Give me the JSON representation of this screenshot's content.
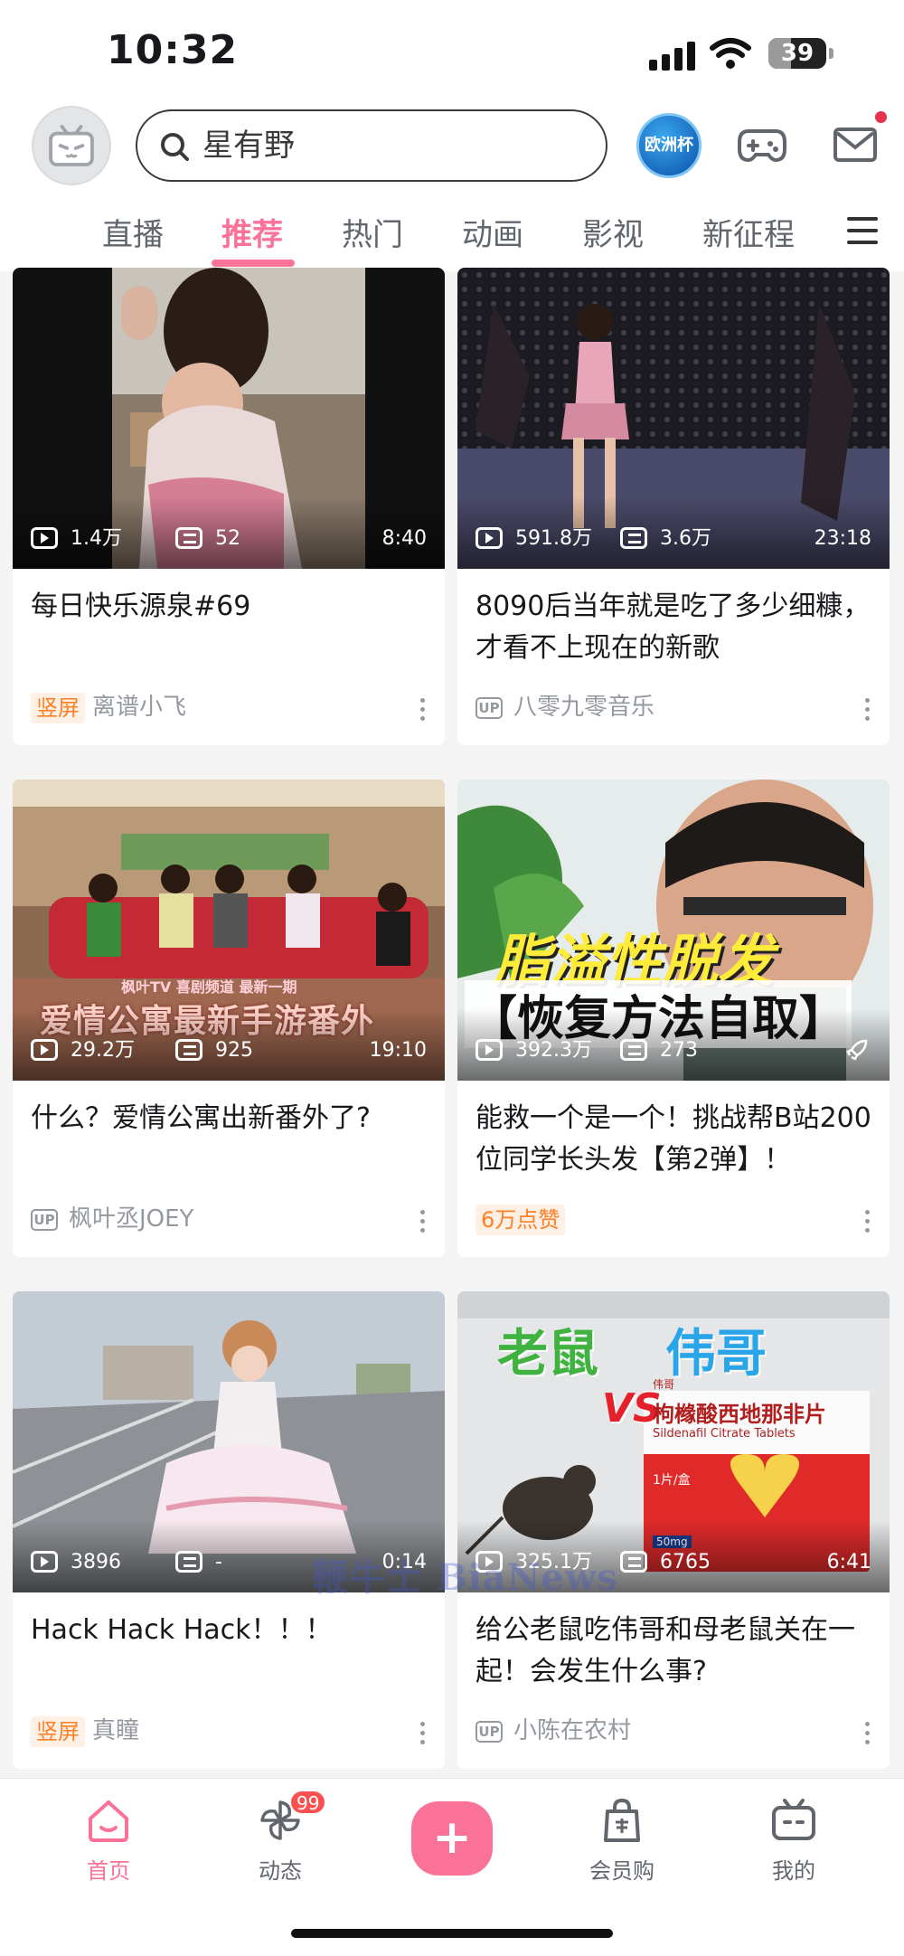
{
  "status_bar": {
    "time": "10:32",
    "battery": "39",
    "battery_level": 0.39
  },
  "header": {
    "search_text": "星有野",
    "euro_badge": "欧洲杯",
    "mail_has_notification": true
  },
  "tabs": [
    {
      "label": "直播"
    },
    {
      "label": "推荐"
    },
    {
      "label": "热门"
    },
    {
      "label": "动画"
    },
    {
      "label": "影视"
    },
    {
      "label": "新征程"
    }
  ],
  "active_tab": "推荐",
  "feed": [
    {
      "title": "每日快乐源泉#69",
      "views": "1.4万",
      "danmaku": "52",
      "duration": "8:40",
      "tag": "竖屏",
      "tag_type": "text",
      "author": "离谱小飞"
    },
    {
      "title": "8090后当年就是吃了多少细糠，才看不上现在的新歌",
      "views": "591.8万",
      "danmaku": "3.6万",
      "duration": "23:18",
      "tag": "UP",
      "tag_type": "up",
      "author": "八零九零音乐"
    },
    {
      "title": "什么？爱情公寓出新番外了?",
      "views": "29.2万",
      "danmaku": "925",
      "duration": "19:10",
      "tag": "UP",
      "tag_type": "up",
      "author": "枫叶丞JOEY",
      "thumb_caption_top": "枫叶TV 喜剧频道 最新一期",
      "thumb_caption": "爱情公寓最新手游番外"
    },
    {
      "title": "能救一个是一个！挑战帮B站200位同学长头发【第2弹】！",
      "views": "392.3万",
      "danmaku": "273",
      "duration": "",
      "tag": "6万点赞",
      "tag_type": "text",
      "author": "",
      "thumb_caption": "脂溢性脱发",
      "thumb_caption_2": "【恢复方法自取】"
    },
    {
      "title": "Hack Hack Hack！！！",
      "views": "3896",
      "danmaku": "-",
      "duration": "0:14",
      "tag": "竖屏",
      "tag_type": "text",
      "author": "真瞳"
    },
    {
      "title": "给公老鼠吃伟哥和母老鼠关在一起！会发生什么事?",
      "views": "325.1万",
      "danmaku": "6765",
      "duration": "6:41",
      "tag": "UP",
      "tag_type": "up",
      "author": "小陈在农村",
      "thumb_caption": "老鼠",
      "thumb_caption_2": "伟哥",
      "thumb_caption_3": "VS",
      "thumb_box_title": "枸橼酸西地那非片",
      "thumb_box_sub": "Sildenafil Citrate Tablets",
      "thumb_box_count": "1片/盒",
      "thumb_box_dose": "50mg",
      "thumb_box_brand": "伟哥"
    }
  ],
  "watermark": "鞭牛士 BiaNews",
  "bottom_nav": [
    {
      "label": "首页"
    },
    {
      "label": "动态",
      "badge": "99"
    },
    {
      "label": ""
    },
    {
      "label": "会员购"
    },
    {
      "label": "我的"
    }
  ],
  "publish_label": "+",
  "colors": {
    "accent": "#fb7299",
    "tag_orange": "#ff7f24",
    "text_secondary": "#9499a0"
  },
  "icons": [
    "search-icon",
    "game-controller-icon",
    "mail-icon",
    "menu-icon",
    "play-icon",
    "danmaku-icon",
    "more-icon",
    "home-icon",
    "pinwheel-icon",
    "shopping-bag-icon",
    "tv-icon",
    "rocket-icon"
  ]
}
